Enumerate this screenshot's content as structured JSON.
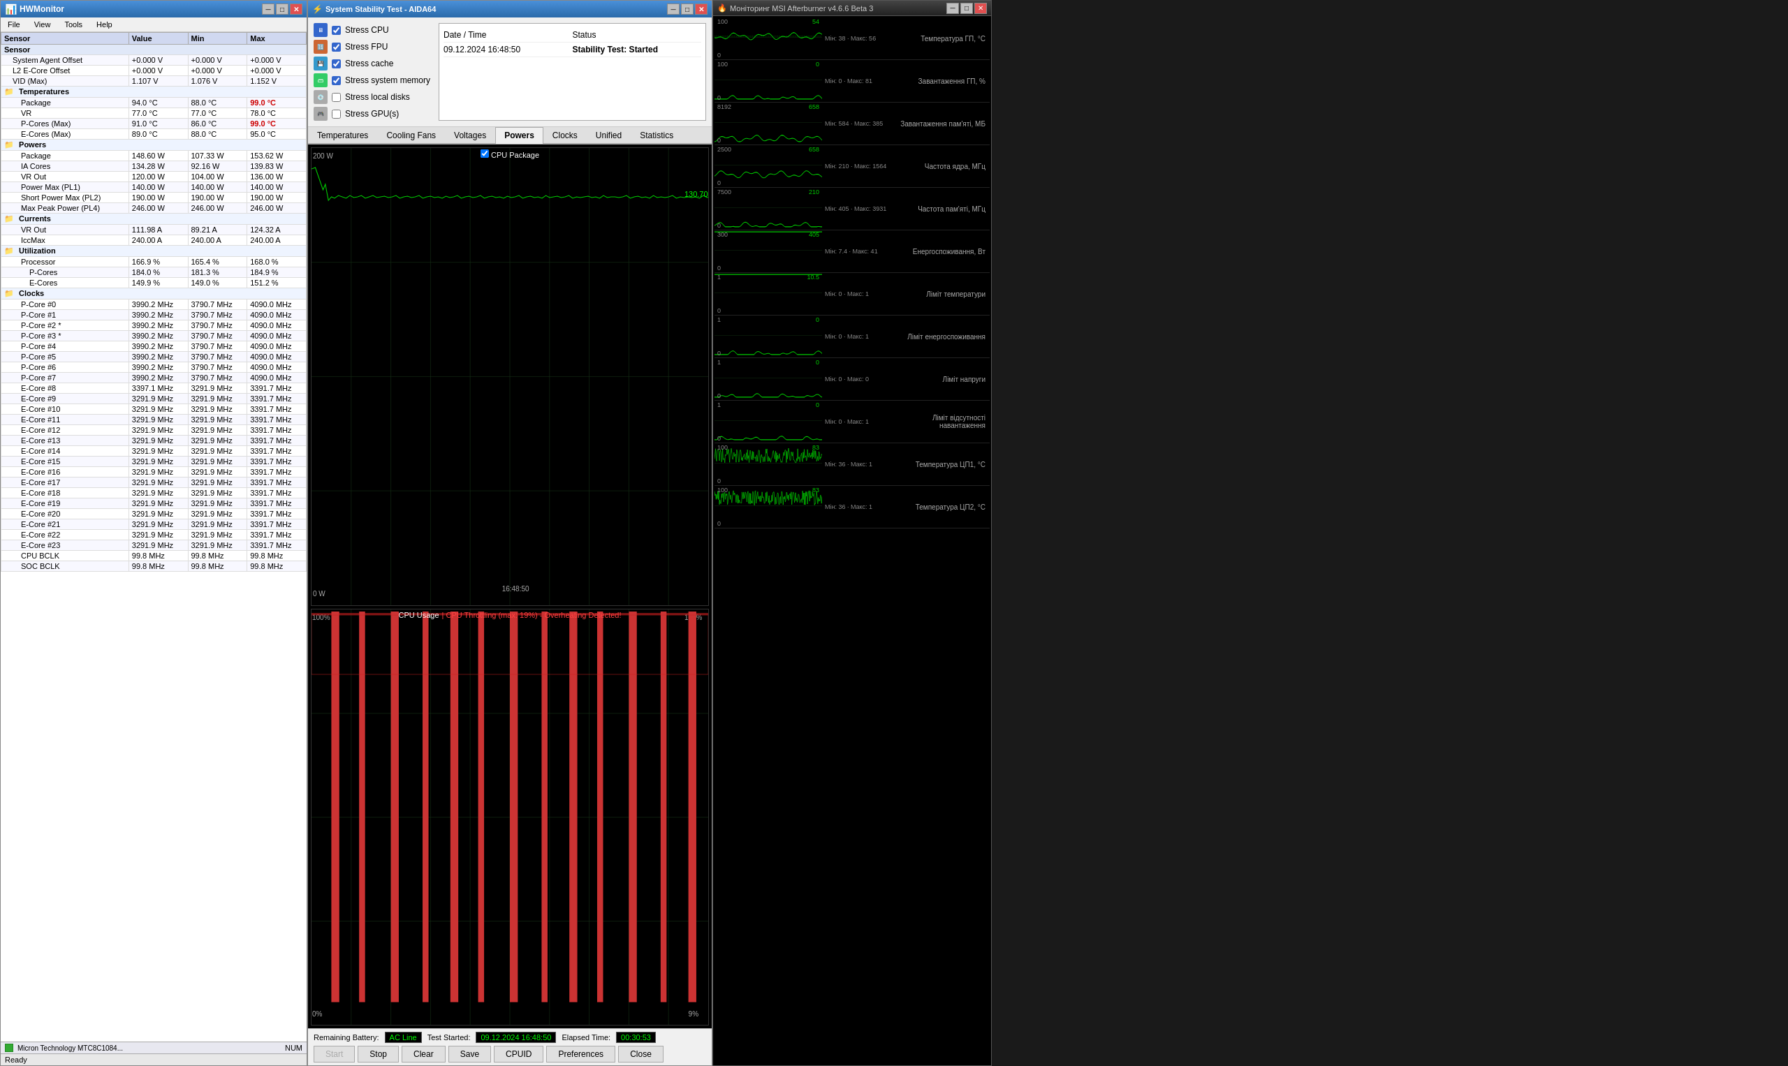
{
  "hwmonitor": {
    "title": "HWMonitor",
    "menu": [
      "File",
      "View",
      "Tools",
      "Help"
    ],
    "columns": [
      "Sensor",
      "Value",
      "Min",
      "Max"
    ],
    "rows": [
      {
        "type": "section",
        "label": "Sensor",
        "indent": 0
      },
      {
        "type": "data",
        "label": "System Agent Offset",
        "value": "+0.000 V",
        "min": "+0.000 V",
        "max": "+0.000 V",
        "indent": 1
      },
      {
        "type": "data",
        "label": "L2 E-Core Offset",
        "value": "+0.000 V",
        "min": "+0.000 V",
        "max": "+0.000 V",
        "indent": 1
      },
      {
        "type": "data",
        "label": "VID (Max)",
        "value": "1.107 V",
        "min": "1.076 V",
        "max": "1.152 V",
        "indent": 1
      },
      {
        "type": "subsection",
        "label": "Temperatures",
        "indent": 0,
        "icon": "folder"
      },
      {
        "type": "data",
        "label": "Package",
        "value": "94.0 °C",
        "min": "88.0 °C",
        "max": "99.0 °C",
        "indent": 2,
        "maxRed": true
      },
      {
        "type": "data",
        "label": "VR",
        "value": "77.0 °C",
        "min": "77.0 °C",
        "max": "78.0 °C",
        "indent": 2
      },
      {
        "type": "data",
        "label": "P-Cores (Max)",
        "value": "91.0 °C",
        "min": "86.0 °C",
        "max": "99.0 °C",
        "indent": 2,
        "maxRed": true
      },
      {
        "type": "data",
        "label": "E-Cores (Max)",
        "value": "89.0 °C",
        "min": "88.0 °C",
        "max": "95.0 °C",
        "indent": 2
      },
      {
        "type": "subsection",
        "label": "Powers",
        "indent": 0,
        "icon": "folder"
      },
      {
        "type": "data",
        "label": "Package",
        "value": "148.60 W",
        "min": "107.33 W",
        "max": "153.62 W",
        "indent": 2
      },
      {
        "type": "data",
        "label": "IA Cores",
        "value": "134.28 W",
        "min": "92.16 W",
        "max": "139.83 W",
        "indent": 2
      },
      {
        "type": "data",
        "label": "VR Out",
        "value": "120.00 W",
        "min": "104.00 W",
        "max": "136.00 W",
        "indent": 2
      },
      {
        "type": "data",
        "label": "Power Max (PL1)",
        "value": "140.00 W",
        "min": "140.00 W",
        "max": "140.00 W",
        "indent": 2
      },
      {
        "type": "data",
        "label": "Short Power Max (PL2)",
        "value": "190.00 W",
        "min": "190.00 W",
        "max": "190.00 W",
        "indent": 2
      },
      {
        "type": "data",
        "label": "Max Peak Power (PL4)",
        "value": "246.00 W",
        "min": "246.00 W",
        "max": "246.00 W",
        "indent": 2
      },
      {
        "type": "subsection",
        "label": "Currents",
        "indent": 0,
        "icon": "folder"
      },
      {
        "type": "data",
        "label": "VR Out",
        "value": "111.98 A",
        "min": "89.21 A",
        "max": "124.32 A",
        "indent": 2
      },
      {
        "type": "data",
        "label": "IccMax",
        "value": "240.00 A",
        "min": "240.00 A",
        "max": "240.00 A",
        "indent": 2
      },
      {
        "type": "subsection",
        "label": "Utilization",
        "indent": 0,
        "icon": "folder"
      },
      {
        "type": "data",
        "label": "Processor",
        "value": "166.9 %",
        "min": "165.4 %",
        "max": "168.0 %",
        "indent": 2
      },
      {
        "type": "data",
        "label": "P-Cores",
        "value": "184.0 %",
        "min": "181.3 %",
        "max": "184.9 %",
        "indent": 3
      },
      {
        "type": "data",
        "label": "E-Cores",
        "value": "149.9 %",
        "min": "149.0 %",
        "max": "151.2 %",
        "indent": 3
      },
      {
        "type": "subsection",
        "label": "Clocks",
        "indent": 0,
        "icon": "folder"
      },
      {
        "type": "data",
        "label": "P-Core #0",
        "value": "3990.2 MHz",
        "min": "3790.7 MHz",
        "max": "4090.0 MHz",
        "indent": 2
      },
      {
        "type": "data",
        "label": "P-Core #1",
        "value": "3990.2 MHz",
        "min": "3790.7 MHz",
        "max": "4090.0 MHz",
        "indent": 2
      },
      {
        "type": "data",
        "label": "P-Core #2 *",
        "value": "3990.2 MHz",
        "min": "3790.7 MHz",
        "max": "4090.0 MHz",
        "indent": 2
      },
      {
        "type": "data",
        "label": "P-Core #3 *",
        "value": "3990.2 MHz",
        "min": "3790.7 MHz",
        "max": "4090.0 MHz",
        "indent": 2
      },
      {
        "type": "data",
        "label": "P-Core #4",
        "value": "3990.2 MHz",
        "min": "3790.7 MHz",
        "max": "4090.0 MHz",
        "indent": 2
      },
      {
        "type": "data",
        "label": "P-Core #5",
        "value": "3990.2 MHz",
        "min": "3790.7 MHz",
        "max": "4090.0 MHz",
        "indent": 2
      },
      {
        "type": "data",
        "label": "P-Core #6",
        "value": "3990.2 MHz",
        "min": "3790.7 MHz",
        "max": "4090.0 MHz",
        "indent": 2
      },
      {
        "type": "data",
        "label": "P-Core #7",
        "value": "3990.2 MHz",
        "min": "3790.7 MHz",
        "max": "4090.0 MHz",
        "indent": 2
      },
      {
        "type": "data",
        "label": "E-Core #8",
        "value": "3397.1 MHz",
        "min": "3291.9 MHz",
        "max": "3391.7 MHz",
        "indent": 2
      },
      {
        "type": "data",
        "label": "E-Core #9",
        "value": "3291.9 MHz",
        "min": "3291.9 MHz",
        "max": "3391.7 MHz",
        "indent": 2
      },
      {
        "type": "data",
        "label": "E-Core #10",
        "value": "3291.9 MHz",
        "min": "3291.9 MHz",
        "max": "3391.7 MHz",
        "indent": 2
      },
      {
        "type": "data",
        "label": "E-Core #11",
        "value": "3291.9 MHz",
        "min": "3291.9 MHz",
        "max": "3391.7 MHz",
        "indent": 2
      },
      {
        "type": "data",
        "label": "E-Core #12",
        "value": "3291.9 MHz",
        "min": "3291.9 MHz",
        "max": "3391.7 MHz",
        "indent": 2
      },
      {
        "type": "data",
        "label": "E-Core #13",
        "value": "3291.9 MHz",
        "min": "3291.9 MHz",
        "max": "3391.7 MHz",
        "indent": 2
      },
      {
        "type": "data",
        "label": "E-Core #14",
        "value": "3291.9 MHz",
        "min": "3291.9 MHz",
        "max": "3391.7 MHz",
        "indent": 2
      },
      {
        "type": "data",
        "label": "E-Core #15",
        "value": "3291.9 MHz",
        "min": "3291.9 MHz",
        "max": "3391.7 MHz",
        "indent": 2
      },
      {
        "type": "data",
        "label": "E-Core #16",
        "value": "3291.9 MHz",
        "min": "3291.9 MHz",
        "max": "3391.7 MHz",
        "indent": 2
      },
      {
        "type": "data",
        "label": "E-Core #17",
        "value": "3291.9 MHz",
        "min": "3291.9 MHz",
        "max": "3391.7 MHz",
        "indent": 2
      },
      {
        "type": "data",
        "label": "E-Core #18",
        "value": "3291.9 MHz",
        "min": "3291.9 MHz",
        "max": "3391.7 MHz",
        "indent": 2
      },
      {
        "type": "data",
        "label": "E-Core #19",
        "value": "3291.9 MHz",
        "min": "3291.9 MHz",
        "max": "3391.7 MHz",
        "indent": 2
      },
      {
        "type": "data",
        "label": "E-Core #20",
        "value": "3291.9 MHz",
        "min": "3291.9 MHz",
        "max": "3391.7 MHz",
        "indent": 2
      },
      {
        "type": "data",
        "label": "E-Core #21",
        "value": "3291.9 MHz",
        "min": "3291.9 MHz",
        "max": "3391.7 MHz",
        "indent": 2
      },
      {
        "type": "data",
        "label": "E-Core #22",
        "value": "3291.9 MHz",
        "min": "3291.9 MHz",
        "max": "3391.7 MHz",
        "indent": 2
      },
      {
        "type": "data",
        "label": "E-Core #23",
        "value": "3291.9 MHz",
        "min": "3291.9 MHz",
        "max": "3391.7 MHz",
        "indent": 2
      },
      {
        "type": "data",
        "label": "CPU BCLK",
        "value": "99.8 MHz",
        "min": "99.8 MHz",
        "max": "99.8 MHz",
        "indent": 2
      },
      {
        "type": "data",
        "label": "SOC BCLK",
        "value": "99.8 MHz",
        "min": "99.8 MHz",
        "max": "99.8 MHz",
        "indent": 2
      }
    ],
    "statusbar": "Ready",
    "statusbar_right": "NUM",
    "device_label": "Micron Technology MTC8C1084..."
  },
  "aida64": {
    "title": "System Stability Test - AIDA64",
    "stress_options": [
      {
        "label": "Stress CPU",
        "checked": true,
        "icon": "cpu"
      },
      {
        "label": "Stress FPU",
        "checked": true,
        "icon": "fpu"
      },
      {
        "label": "Stress cache",
        "checked": true,
        "icon": "cache"
      },
      {
        "label": "Stress system memory",
        "checked": true,
        "icon": "mem"
      },
      {
        "label": "Stress local disks",
        "checked": false,
        "icon": "disk"
      },
      {
        "label": "Stress GPU(s)",
        "checked": false,
        "icon": "gpu"
      }
    ],
    "status": {
      "date_label": "Date / Time",
      "status_label": "Status",
      "date_value": "09.12.2024 16:48:50",
      "status_value": "Stability Test: Started"
    },
    "tabs": [
      "Temperatures",
      "Cooling Fans",
      "Voltages",
      "Powers",
      "Clocks",
      "Unified",
      "Statistics"
    ],
    "active_tab": "Powers",
    "chart1": {
      "title": "CPU Package",
      "y_max": "200 W",
      "y_min": "0 W",
      "x_label": "16:48:50",
      "last_value": "130.70"
    },
    "chart2": {
      "title": "CPU Usage",
      "throttle_text": "CPU Throttling (max: 19%) - Overheating Detected!",
      "y_max": "100%",
      "y_min": "0%",
      "right_value_top": "100%",
      "right_value_bot": "9%"
    },
    "battery": {
      "label": "Remaining Battery:",
      "value": "AC Line",
      "test_started_label": "Test Started:",
      "test_started_value": "09.12.2024 16:48:50",
      "elapsed_label": "Elapsed Time:",
      "elapsed_value": "00:30:53"
    },
    "buttons": [
      "Start",
      "Stop",
      "Clear",
      "Save",
      "CPUID",
      "Preferences",
      "Close"
    ]
  },
  "msi": {
    "title": "Моніторинг MSI Afterburner v4.6.6 Beta 3",
    "sensors": [
      {
        "label": "Температура ГП, °C",
        "min": 38,
        "max": 56,
        "current": 54,
        "scale_max": 100,
        "color": "#00cc00"
      },
      {
        "label": "Завантаження ГП, %",
        "min": 0,
        "max": 81,
        "current": 0,
        "scale_max": 100,
        "color": "#00cc00"
      },
      {
        "label": "Завантаження пам'яті, МБ",
        "min": 584,
        "max": 385,
        "current": 658,
        "scale_max": 8192,
        "color": "#00cc00"
      },
      {
        "label": "Частота ядра, МГц",
        "min": 210,
        "max": 1564,
        "current": 658,
        "scale_max": 2500,
        "color": "#00cc00"
      },
      {
        "label": "Частота пам'яті, МГц",
        "min": 405,
        "max": 3931,
        "current": 210,
        "scale_max": 7500,
        "color": "#00cc00"
      },
      {
        "label": "Енергоспоживання, Вт",
        "min": 7.4,
        "max": 41,
        "current": 405,
        "scale_max": 300,
        "color": "#00cc00"
      },
      {
        "label": "Ліміт температури",
        "min": 0,
        "max": 1,
        "current": 10.5,
        "scale_max": 1.0,
        "color": "#00cc00"
      },
      {
        "label": "Ліміт енергоспоживання",
        "min": 0,
        "max": 1,
        "current": 0,
        "scale_max": 1.0,
        "color": "#00cc00"
      },
      {
        "label": "Ліміт напруги",
        "min": 0,
        "max": 0,
        "current": 0,
        "scale_max": 1.0,
        "color": "#00cc00"
      },
      {
        "label": "Ліміт відсутності навантаження",
        "min": 0,
        "max": 1,
        "current": 0,
        "scale_max": 1.0,
        "color": "#00cc00"
      },
      {
        "label": "Температура ЦП1, °C",
        "min": 36,
        "max": 1,
        "current": 83,
        "scale_max": 100,
        "color": "#00cc00"
      },
      {
        "label": "Температура ЦП2, °C",
        "min": 36,
        "max": 1,
        "current": 83,
        "scale_max": 100,
        "color": "#00cc00"
      }
    ]
  }
}
